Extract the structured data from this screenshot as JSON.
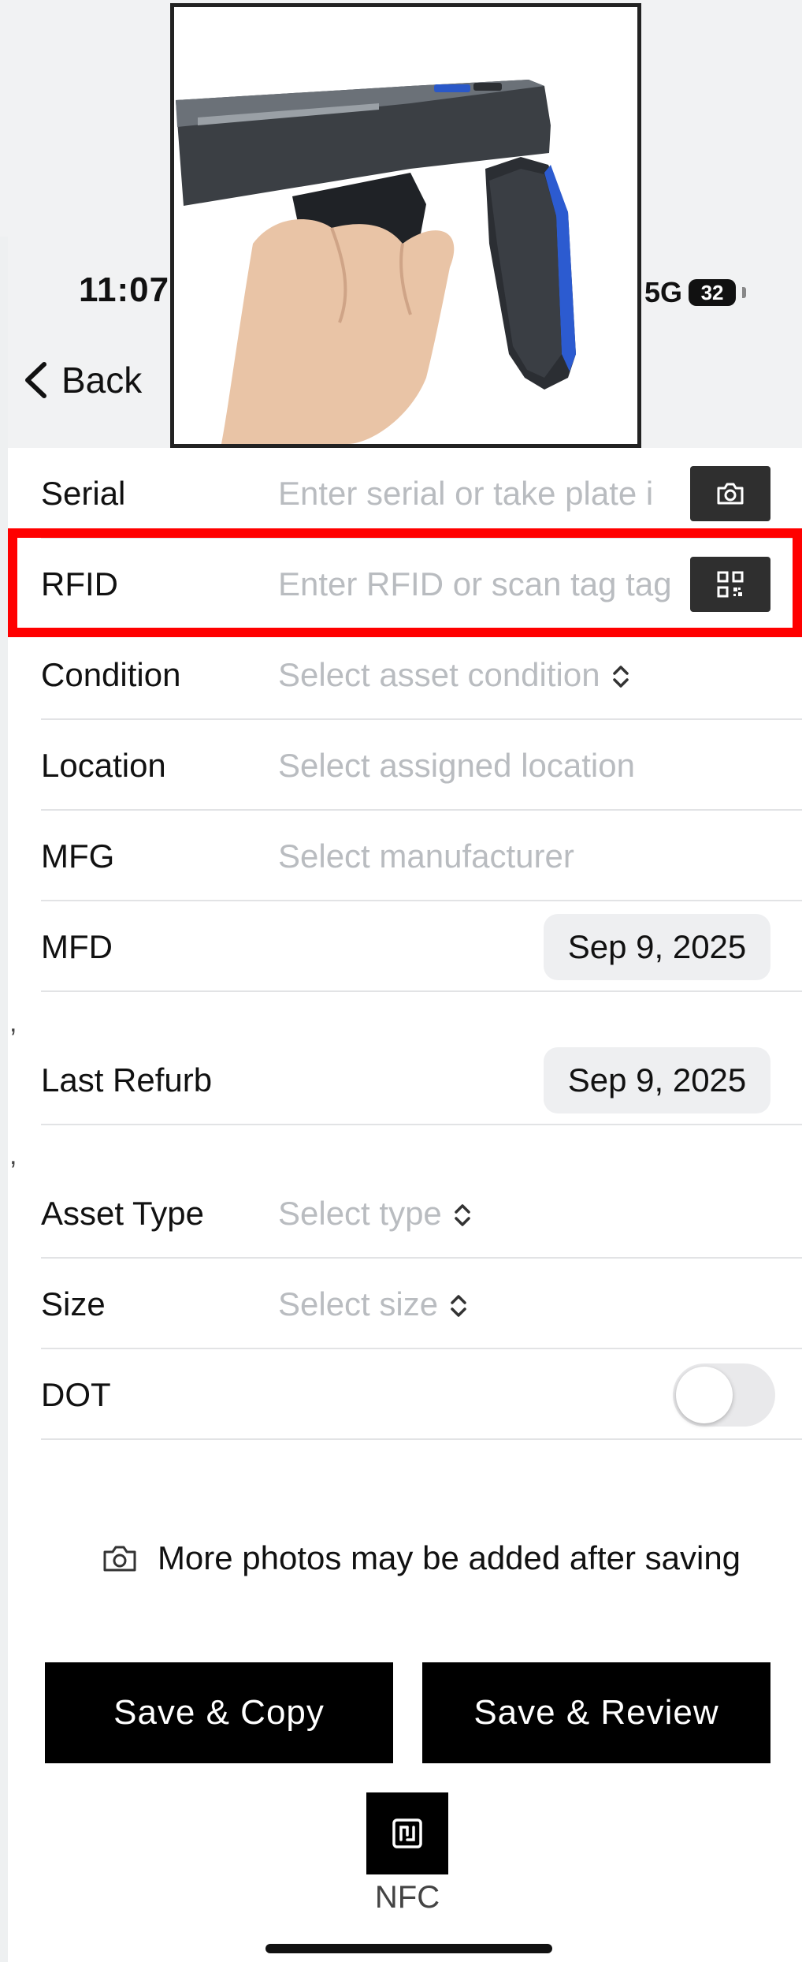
{
  "status_bar": {
    "time": "11:07",
    "network": "5G",
    "battery": "32"
  },
  "nav": {
    "back_label": "Back"
  },
  "form": {
    "serial": {
      "label": "Serial",
      "placeholder": "Enter serial or take plate i"
    },
    "rfid": {
      "label": "RFID",
      "placeholder": "Enter RFID or scan tag tag"
    },
    "condition": {
      "label": "Condition",
      "placeholder": "Select asset condition"
    },
    "location": {
      "label": "Location",
      "placeholder": "Select assigned location"
    },
    "mfg": {
      "label": "MFG",
      "placeholder": "Select manufacturer"
    },
    "mfd": {
      "label": "MFD",
      "value": "Sep 9, 2025"
    },
    "last_refurb": {
      "label": "Last Refurb",
      "value": "Sep 9, 2025"
    },
    "asset_type": {
      "label": "Asset Type",
      "placeholder": "Select type"
    },
    "size": {
      "label": "Size",
      "placeholder": "Select size"
    },
    "dot": {
      "label": "DOT",
      "on": false
    }
  },
  "photo_note": "More photos may be added after saving",
  "buttons": {
    "save_copy": "Save & Copy",
    "save_review": "Save & Review"
  },
  "nfc": {
    "label": "NFC"
  },
  "colors": {
    "highlight": "#ff0000",
    "button_bg": "#000000",
    "placeholder": "#b9bcc0"
  },
  "icons": [
    "chevron-left-icon",
    "camera-icon",
    "qr-code-icon",
    "up-down-chevron-icon",
    "nfc-icon"
  ]
}
